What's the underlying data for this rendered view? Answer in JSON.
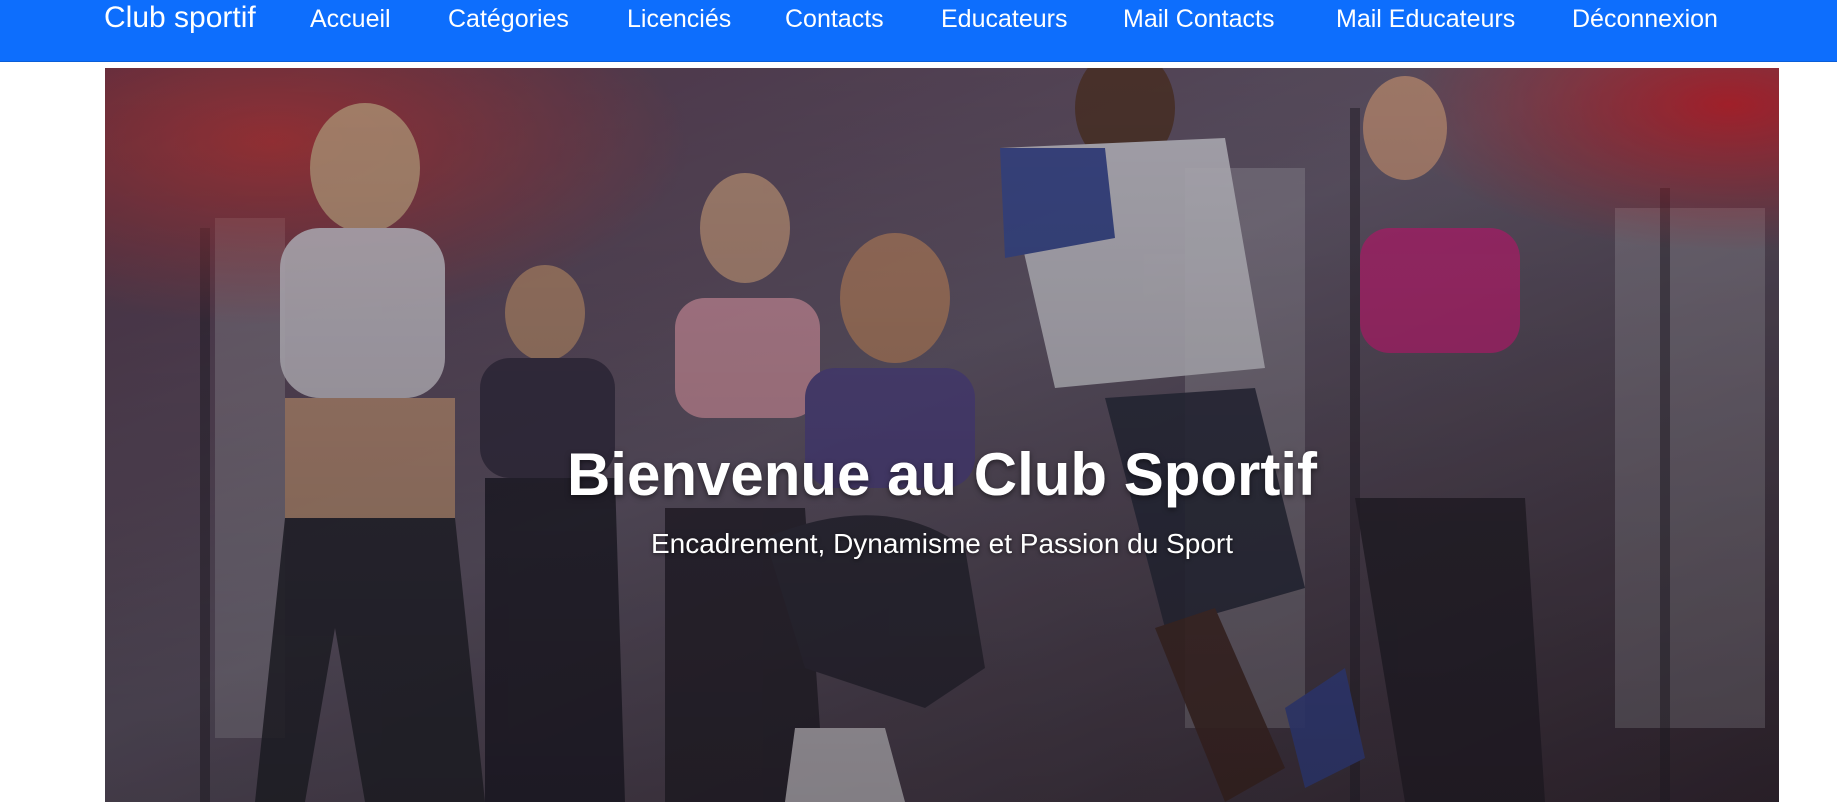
{
  "navbar": {
    "brand": "Club sportif",
    "items": [
      {
        "label": "Accueil"
      },
      {
        "label": "Catégories"
      },
      {
        "label": "Licenciés"
      },
      {
        "label": "Contacts"
      },
      {
        "label": "Educateurs"
      },
      {
        "label": "Mail Contacts"
      },
      {
        "label": "Mail Educateurs"
      },
      {
        "label": "Déconnexion"
      }
    ]
  },
  "hero": {
    "title": "Bienvenue au Club Sportif",
    "subtitle": "Encadrement, Dynamisme et Passion du Sport"
  },
  "colors": {
    "navbar_bg": "#0d6efd",
    "nav_text": "#ffffff",
    "hero_text": "#ffffff"
  }
}
